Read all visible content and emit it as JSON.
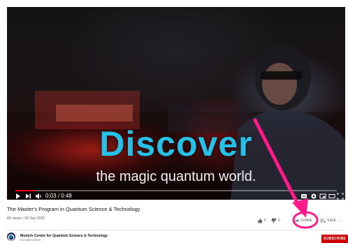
{
  "player": {
    "overlay_title": "Discover",
    "overlay_subtitle": "the magic quantum world.",
    "time_display": "0:03 / 0:48",
    "progress": 0.06,
    "accent_color": "#ff0000",
    "title_color": "#27c0e6",
    "icons": [
      "play-icon",
      "next-icon",
      "volume-icon",
      "subtitles-icon",
      "settings-icon",
      "miniplayer-icon",
      "theater-icon",
      "fullscreen-icon"
    ]
  },
  "video": {
    "title": "The Master's Program in Quantum Science & Technology",
    "meta": "80 views • 29 Sep 2020",
    "likes": "5",
    "dislikes": "0",
    "share_label": "SHARE",
    "save_label": "SAVE",
    "more_label": "..."
  },
  "channel": {
    "name": "Munich Center for Quantum Science & Technology",
    "subscribers": "64 subscribers",
    "subscribe_label": "SUBSCRIBE",
    "subscribe_color": "#cc0000"
  },
  "annotation": {
    "color": "#ff1a8c",
    "target": "share-button"
  }
}
